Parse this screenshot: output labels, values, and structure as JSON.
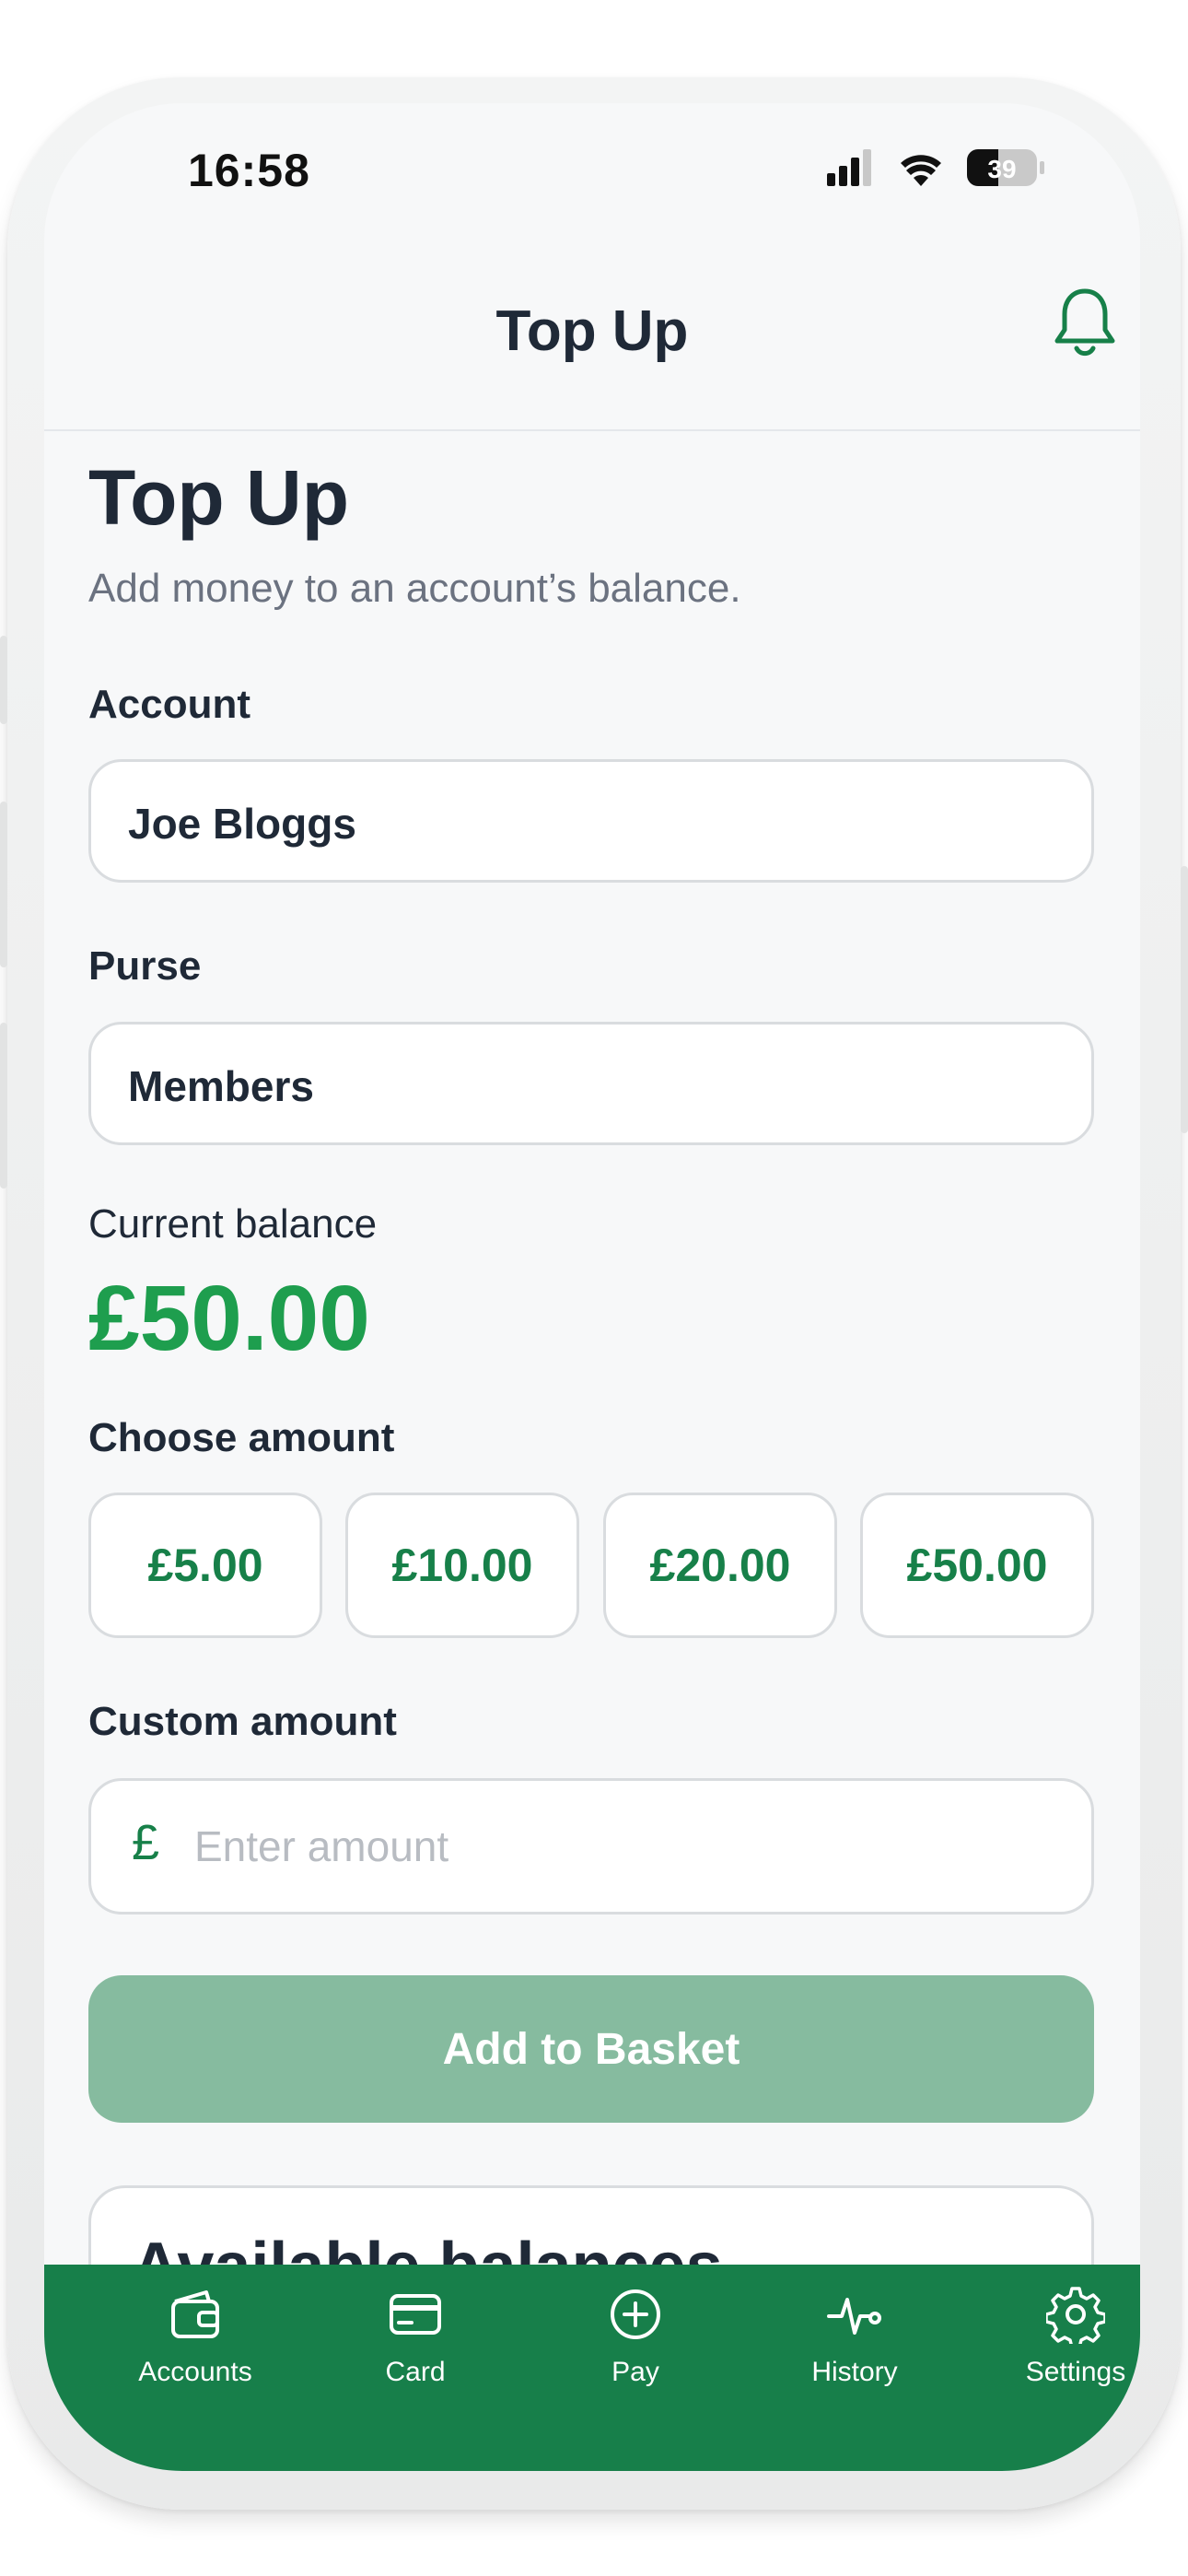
{
  "status_bar": {
    "time": "16:58",
    "battery": "39"
  },
  "nav": {
    "title": "Top Up"
  },
  "page": {
    "title": "Top Up",
    "subtitle": "Add money to an account’s balance."
  },
  "account": {
    "label": "Account",
    "value": "Joe Bloggs"
  },
  "purse": {
    "label": "Purse",
    "value": "Members"
  },
  "balance": {
    "label": "Current balance",
    "value": "£50.00"
  },
  "choose_amount": {
    "label": "Choose amount",
    "options": [
      "£5.00",
      "£10.00",
      "£20.00",
      "£50.00"
    ]
  },
  "custom_amount": {
    "label": "Custom amount",
    "currency_symbol": "£",
    "placeholder": "Enter amount",
    "value": ""
  },
  "basket_button": {
    "label": "Add to Basket"
  },
  "available_balances": {
    "title": "Available balances"
  },
  "tabs": [
    {
      "label": "Accounts",
      "icon": "wallet-icon"
    },
    {
      "label": "Card",
      "icon": "card-icon"
    },
    {
      "label": "Pay",
      "icon": "plus-circle-icon"
    },
    {
      "label": "History",
      "icon": "activity-icon"
    },
    {
      "label": "Settings",
      "icon": "gear-icon"
    }
  ],
  "colors": {
    "brand": "#177f4a",
    "balance_green": "#1e9e4e",
    "disabled_button": "#86bb9f",
    "text_primary": "#1f2937",
    "text_secondary": "#6b7280"
  }
}
